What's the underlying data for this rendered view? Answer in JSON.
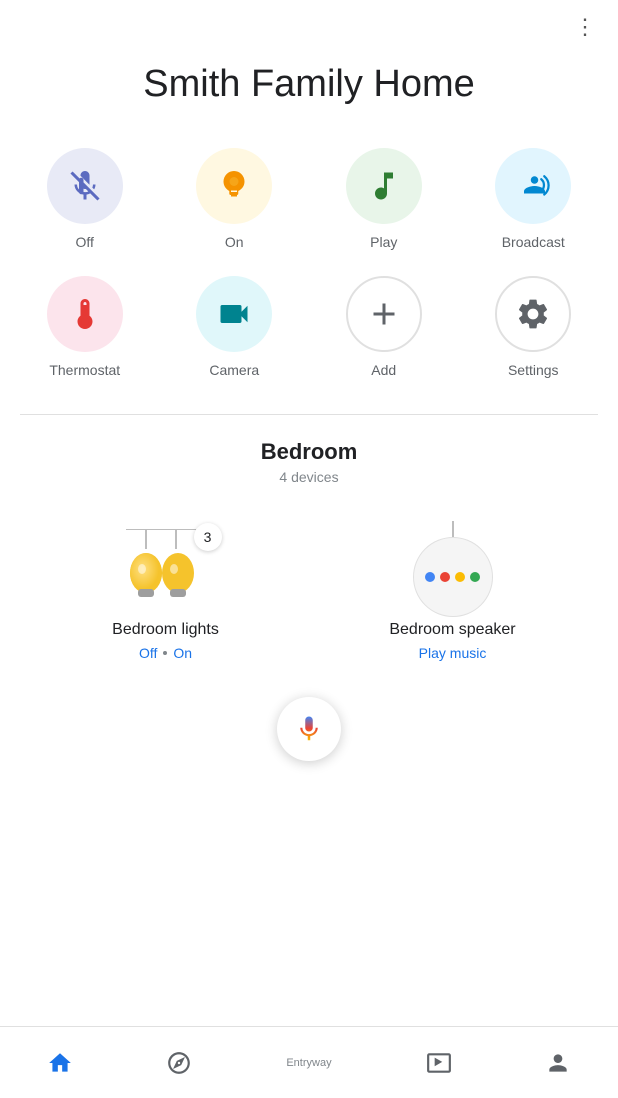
{
  "app": {
    "title": "Smith Family Home",
    "more_menu_icon": "⋮"
  },
  "quick_actions": [
    {
      "id": "off",
      "label": "Off",
      "circle_class": "circle-blue-gray",
      "icon_type": "off"
    },
    {
      "id": "on",
      "label": "On",
      "circle_class": "circle-yellow",
      "icon_type": "on"
    },
    {
      "id": "play",
      "label": "Play",
      "circle_class": "circle-green",
      "icon_type": "play"
    },
    {
      "id": "broadcast",
      "label": "Broadcast",
      "circle_class": "circle-light-blue",
      "icon_type": "broadcast"
    },
    {
      "id": "thermostat",
      "label": "Thermostat",
      "circle_class": "circle-pink",
      "icon_type": "thermostat"
    },
    {
      "id": "camera",
      "label": "Camera",
      "circle_class": "circle-cyan",
      "icon_type": "camera"
    },
    {
      "id": "add",
      "label": "Add",
      "circle_class": "circle-white-border",
      "icon_type": "add"
    },
    {
      "id": "settings",
      "label": "Settings",
      "circle_class": "circle-white-border",
      "icon_type": "settings"
    }
  ],
  "room": {
    "name": "Bedroom",
    "device_count": "4 devices"
  },
  "devices": [
    {
      "id": "bedroom-lights",
      "name": "Bedroom lights",
      "badge": "3",
      "status_off": "Off",
      "status_on": "On",
      "action": null
    },
    {
      "id": "bedroom-speaker",
      "name": "Bedroom speaker",
      "badge": null,
      "status_off": null,
      "status_on": null,
      "action": "Play music"
    }
  ],
  "bottom_nav": [
    {
      "id": "home",
      "label": "Home",
      "active": true
    },
    {
      "id": "explore",
      "label": "Explore",
      "active": false
    },
    {
      "id": "entryway",
      "label": "Entryway",
      "active": false,
      "center_label": true
    },
    {
      "id": "media",
      "label": "Media",
      "active": false
    },
    {
      "id": "profile",
      "label": "Profile",
      "active": false
    }
  ],
  "entryway_label": "Entryway"
}
